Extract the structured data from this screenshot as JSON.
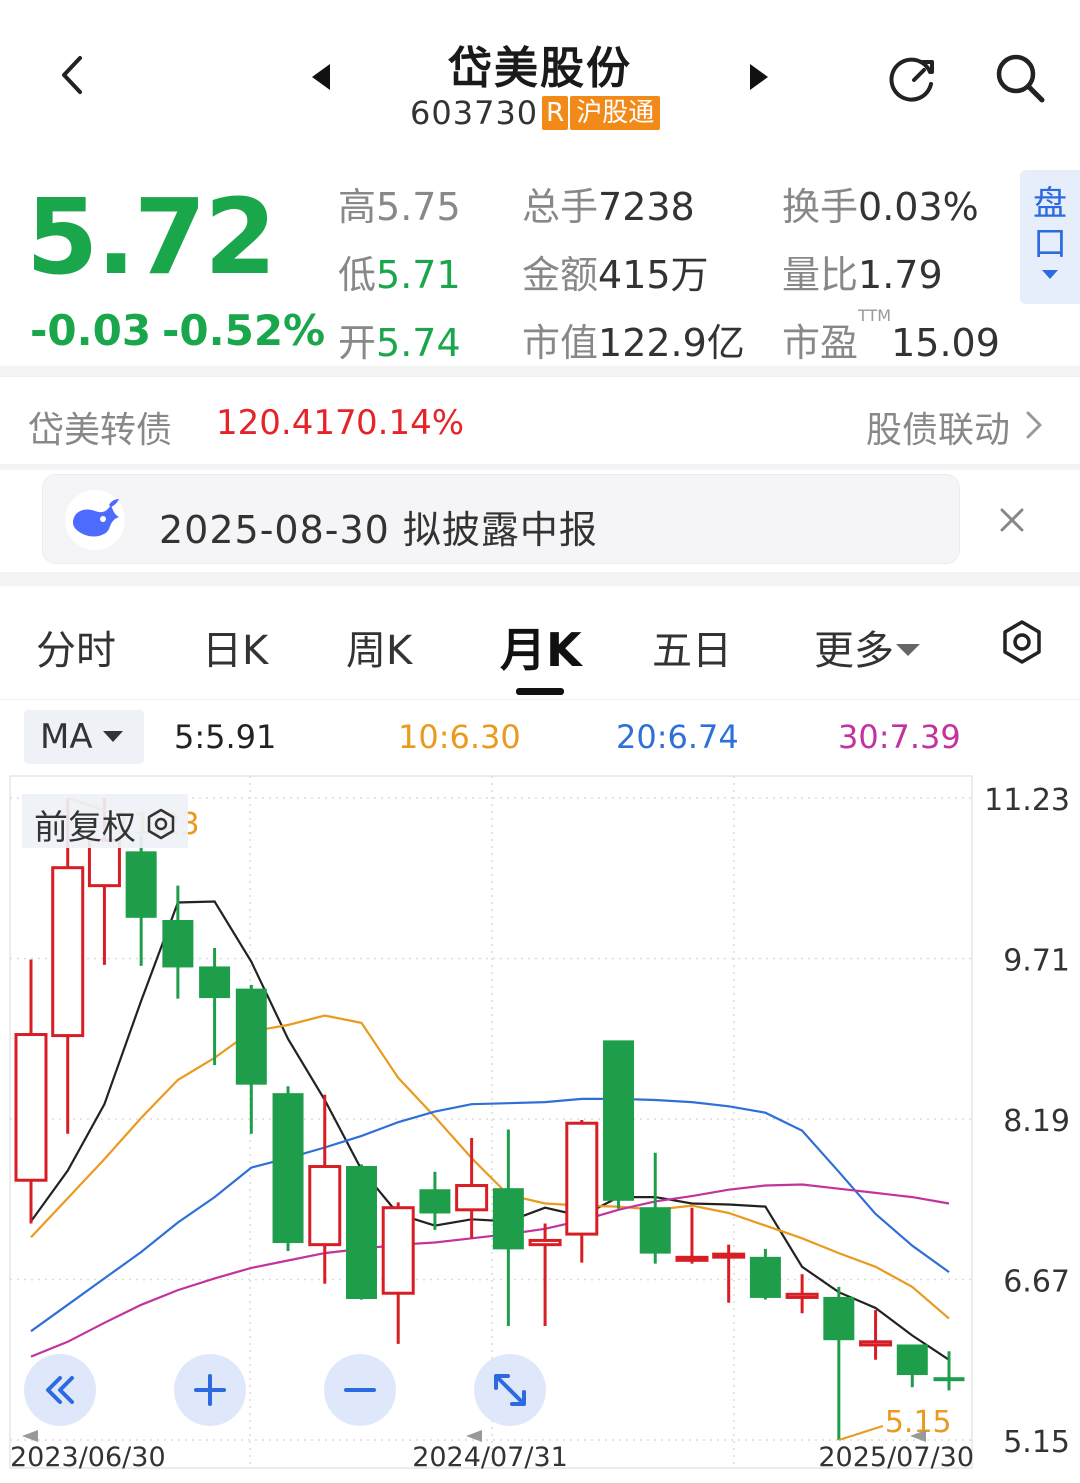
{
  "header": {
    "title": "岱美股份",
    "code": "603730",
    "r_badge": "R",
    "connect_badge": "沪股通"
  },
  "quote": {
    "price": "5.72",
    "change": "-0.03",
    "change_pct": "-0.52%",
    "high_label": "高",
    "high": "5.75",
    "low_label": "低",
    "low": "5.71",
    "open_label": "开",
    "open": "5.74",
    "volume_label": "总手",
    "volume": "7238",
    "amount_label": "金额",
    "amount": "415万",
    "mktcap_label": "市值",
    "mktcap": "122.9亿",
    "turnover_label": "换手",
    "turnover": "0.03%",
    "vol_ratio_label": "量比",
    "vol_ratio": "1.79",
    "pe_label": "市盈",
    "pe_sup": "TTM",
    "pe": "15.09",
    "pankou": "盘口"
  },
  "bond": {
    "name": "岱美转债",
    "price": "120.417",
    "pct": "0.14%",
    "link": "股债联动"
  },
  "notice": {
    "text": "2025-08-30 拟披露中报"
  },
  "tabs": [
    {
      "label": "分时"
    },
    {
      "label": "日K"
    },
    {
      "label": "周K"
    },
    {
      "label": "月K"
    },
    {
      "label": "五日"
    },
    {
      "label": "更多"
    }
  ],
  "ma": {
    "button": "MA",
    "ma5": "5:5.91",
    "ma10": "10:6.30",
    "ma20": "20:6.74",
    "ma30": "30:7.39"
  },
  "adjust_label": "前复权",
  "colors": {
    "up": "#d81e25",
    "down": "#1e9e4a",
    "ma5": "#222222",
    "ma10": "#ea9a1e",
    "ma20": "#2f6fd8",
    "ma30": "#c2339e",
    "accent": "#2c6bdf"
  },
  "chart_data": {
    "type": "candlestick",
    "y_ticks": [
      "11.23",
      "9.71",
      "8.19",
      "6.67",
      "5.15"
    ],
    "ylim": [
      5.15,
      11.23
    ],
    "x_labels": [
      "2023/06/30",
      "2024/07/31",
      "2025/07/30"
    ],
    "max_label": "11.23",
    "min_label": "5.15",
    "candles": [
      {
        "o": 7.61,
        "c": 8.99,
        "h": 9.7,
        "l": 7.2
      },
      {
        "o": 8.98,
        "c": 10.57,
        "h": 11.23,
        "l": 8.05
      },
      {
        "o": 10.4,
        "c": 10.83,
        "h": 11.23,
        "l": 9.65
      },
      {
        "o": 10.72,
        "c": 10.1,
        "h": 10.88,
        "l": 9.64
      },
      {
        "o": 10.07,
        "c": 9.63,
        "h": 10.4,
        "l": 9.33
      },
      {
        "o": 9.63,
        "c": 9.34,
        "h": 9.81,
        "l": 8.7
      },
      {
        "o": 9.42,
        "c": 8.52,
        "h": 9.46,
        "l": 8.05
      },
      {
        "o": 8.43,
        "c": 7.02,
        "h": 8.5,
        "l": 6.94
      },
      {
        "o": 7.0,
        "c": 7.74,
        "h": 8.42,
        "l": 6.63
      },
      {
        "o": 7.74,
        "c": 6.49,
        "h": 7.76,
        "l": 6.48
      },
      {
        "o": 6.54,
        "c": 7.35,
        "h": 7.4,
        "l": 6.06
      },
      {
        "o": 7.52,
        "c": 7.3,
        "h": 7.69,
        "l": 7.14
      },
      {
        "o": 7.33,
        "c": 7.56,
        "h": 8.01,
        "l": 7.06
      },
      {
        "o": 7.53,
        "c": 6.96,
        "h": 8.09,
        "l": 6.23
      },
      {
        "o": 7.0,
        "c": 7.04,
        "h": 7.2,
        "l": 6.23
      },
      {
        "o": 7.1,
        "c": 8.15,
        "h": 8.18,
        "l": 6.83
      },
      {
        "o": 8.93,
        "c": 7.42,
        "h": 8.93,
        "l": 7.34
      },
      {
        "o": 7.35,
        "c": 6.92,
        "h": 7.87,
        "l": 6.82
      },
      {
        "o": 6.88,
        "c": 6.88,
        "h": 7.35,
        "l": 6.82
      },
      {
        "o": 6.89,
        "c": 6.91,
        "h": 7.0,
        "l": 6.45
      },
      {
        "o": 6.88,
        "c": 6.5,
        "h": 6.96,
        "l": 6.48
      },
      {
        "o": 6.5,
        "c": 6.53,
        "h": 6.72,
        "l": 6.35
      },
      {
        "o": 6.5,
        "c": 6.1,
        "h": 6.6,
        "l": 5.15
      },
      {
        "o": 6.05,
        "c": 6.08,
        "h": 6.38,
        "l": 5.91
      },
      {
        "o": 6.05,
        "c": 5.77,
        "h": 6.04,
        "l": 5.65
      },
      {
        "o": 5.74,
        "c": 5.73,
        "h": 5.99,
        "l": 5.62
      }
    ],
    "series": [
      {
        "name": "MA5",
        "values": [
          7.22,
          7.7,
          8.33,
          9.31,
          10.24,
          10.25,
          9.68,
          8.95,
          8.37,
          7.71,
          7.29,
          7.18,
          7.24,
          7.22,
          7.35,
          7.27,
          7.45,
          7.45,
          7.39,
          7.38,
          7.36,
          6.79,
          6.55,
          6.4,
          6.14,
          5.91
        ]
      },
      {
        "name": "MA10",
        "values": [
          7.07,
          7.44,
          7.81,
          8.2,
          8.56,
          8.77,
          9.02,
          9.08,
          9.17,
          9.1,
          8.58,
          8.21,
          7.82,
          7.47,
          7.39,
          7.37,
          7.36,
          7.33,
          7.37,
          7.3,
          7.18,
          7.06,
          6.92,
          6.79,
          6.6,
          6.3
        ]
      },
      {
        "name": "MA20",
        "values": [
          6.18,
          6.43,
          6.68,
          6.93,
          7.21,
          7.45,
          7.73,
          7.82,
          7.92,
          8.03,
          8.16,
          8.26,
          8.33,
          8.34,
          8.35,
          8.38,
          8.38,
          8.37,
          8.35,
          8.31,
          8.25,
          8.08,
          7.69,
          7.29,
          6.99,
          6.74
        ]
      },
      {
        "name": "MA30",
        "values": [
          5.94,
          6.08,
          6.26,
          6.43,
          6.57,
          6.68,
          6.78,
          6.85,
          6.92,
          6.96,
          7.0,
          7.02,
          7.06,
          7.1,
          7.15,
          7.23,
          7.33,
          7.41,
          7.46,
          7.52,
          7.56,
          7.57,
          7.53,
          7.49,
          7.45,
          7.39
        ]
      }
    ]
  }
}
